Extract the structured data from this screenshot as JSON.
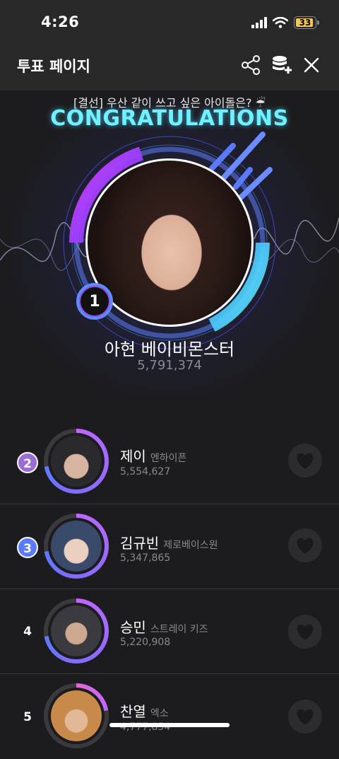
{
  "status": {
    "time": "4:26",
    "battery": "33"
  },
  "header": {
    "title": "투표 페이지",
    "icons": [
      "share-icon",
      "database-add-icon",
      "close-icon"
    ]
  },
  "hero": {
    "subtitle": "[결선] 우산 같이 쓰고 싶은 아이돌은? ☔",
    "congrats": "CONGRATULATIONS",
    "rank": "1",
    "name": "아현 베이비몬스터",
    "votes": "5,791,374"
  },
  "ranking": [
    {
      "rank": "2",
      "name": "제이",
      "group": "엔하이픈",
      "votes": "5,554,627",
      "badge": true,
      "badge_color": "#9b6bd6"
    },
    {
      "rank": "3",
      "name": "김규빈",
      "group": "제로베이스원",
      "votes": "5,347,865",
      "badge": true,
      "badge_color": "#5b7bff"
    },
    {
      "rank": "4",
      "name": "승민",
      "group": "스트레이 키즈",
      "votes": "5,220,908",
      "badge": false
    },
    {
      "rank": "5",
      "name": "찬열",
      "group": "엑소",
      "votes": "4,777,854",
      "badge": false
    }
  ],
  "colors": {
    "accent_cyan": "#6ff1ff",
    "accent_purple": "#c067ff",
    "accent_blue": "#5b7bff",
    "background": "#1c1c1e"
  }
}
